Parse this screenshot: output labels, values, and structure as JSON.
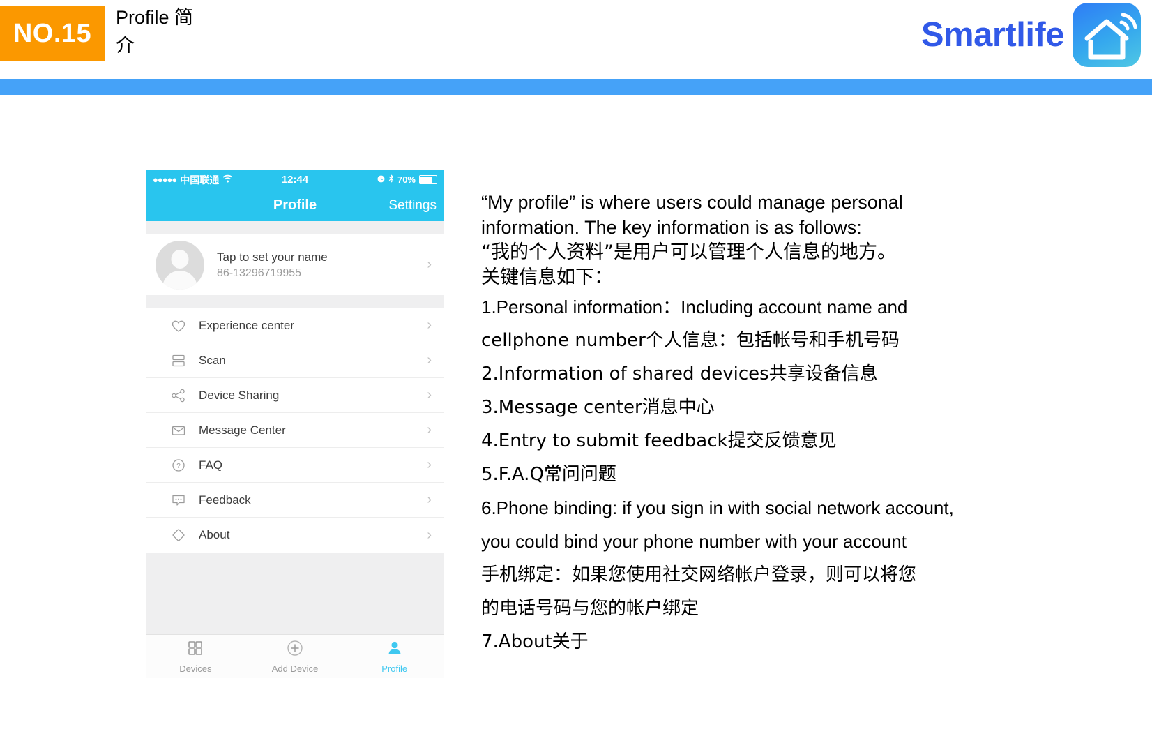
{
  "header": {
    "badge": "NO.15",
    "title": "Profile 简介",
    "brand": "Smartlife",
    "logo_icon": "smart-home-wifi-icon",
    "badge_color": "#FB9800",
    "brand_color": "#3159E8",
    "rule_color": "#45A2F8"
  },
  "phone": {
    "status_bar": {
      "signal_dots": "●●●●●",
      "carrier": "中国联通",
      "wifi_icon": "wifi-icon",
      "time": "12:44",
      "alarm_icon": "alarm-icon",
      "bluetooth_icon": "bluetooth-icon",
      "battery_percent": "70%"
    },
    "nav": {
      "title": "Profile",
      "action": "Settings",
      "bar_color": "#29C5EE"
    },
    "profile": {
      "avatar_icon": "user-avatar-placeholder-icon",
      "name": "Tap to set your name",
      "phone_number": "86-13296719955",
      "chevron": "›"
    },
    "menu": [
      {
        "label": "Experience center",
        "icon": "heart-icon",
        "chevron": "›"
      },
      {
        "label": "Scan",
        "icon": "scan-icon",
        "chevron": "›"
      },
      {
        "label": "Device Sharing",
        "icon": "share-icon",
        "chevron": "›"
      },
      {
        "label": "Message Center",
        "icon": "envelope-icon",
        "chevron": "›"
      },
      {
        "label": "FAQ",
        "icon": "question-circle-icon",
        "chevron": "›"
      },
      {
        "label": "Feedback",
        "icon": "comment-icon",
        "chevron": "›"
      },
      {
        "label": "About",
        "icon": "diamond-icon",
        "chevron": "›"
      }
    ],
    "tabs": [
      {
        "label": "Devices",
        "icon": "grid-icon",
        "active": false
      },
      {
        "label": "Add Device",
        "icon": "plus-circle-icon",
        "active": false
      },
      {
        "label": "Profile",
        "icon": "person-icon",
        "active": true
      }
    ]
  },
  "description": {
    "intro_en": "“My profile” is where users could manage personal",
    "intro_en2": "information. The key information is as follows:",
    "intro_cn": "“我的个人资料”是用户可以管理个人信息的地方。",
    "intro_cn2": "关键信息如下：",
    "items": [
      "1.Personal information：Including account name and",
      "cellphone number个人信息：包括帐号和手机号码",
      "2.Information of shared devices共享设备信息",
      "3.Message center消息中心",
      "4.Entry to submit feedback提交反馈意见",
      "5.F.A.Q常问问题",
      "6.Phone binding: if you sign in with social network account,",
      "you could bind your phone number with your account",
      "手机绑定：如果您使用社交网络帐户登录，则可以将您",
      "的电话号码与您的帐户绑定",
      "7.About关于"
    ]
  }
}
